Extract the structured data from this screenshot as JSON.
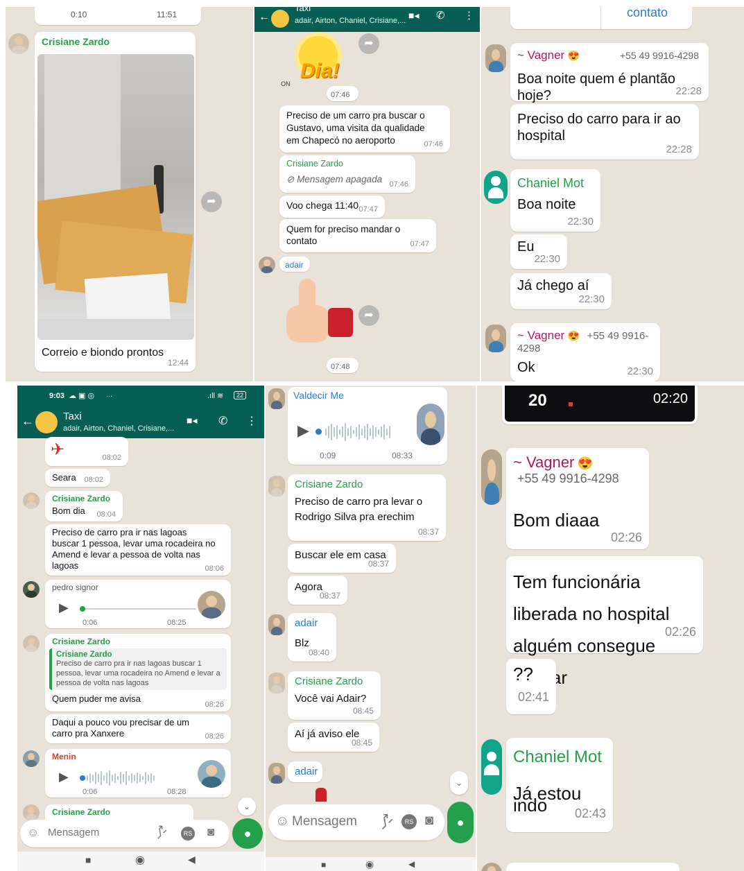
{
  "colors": {
    "header_bg": "#075e54",
    "chat_bg": "#e9e2d8",
    "sender_green": "#25a04a",
    "sender_pink": "#b0185c",
    "mic_green": "#25a04a"
  },
  "panel1": {
    "top_bubble_left": "0:10",
    "top_bubble_right": "11:51",
    "sender": "Crisiane Zardo",
    "caption": "Correio e biondo prontos",
    "time": "12:44"
  },
  "panel2": {
    "title": "Taxi",
    "members": "adair, Airton, Chaniel, Crisiane,...",
    "sticker_time": "07:46",
    "sticker_text": "Dia!",
    "msg1": "Preciso de um carro pra buscar o Gustavo, uma visita da qualidade em Chapecó no aeroporto",
    "msg1_time": "07:46",
    "deleted_sender": "Crisiane Zardo",
    "deleted_text": "Mensagem apagada",
    "deleted_time": "07:46",
    "msg2": "Voo chega 11:40",
    "msg2_time": "07:47",
    "msg3": "Quem for preciso mandar o contato",
    "msg3_time": "07:47",
    "adair_label": "adair",
    "thumb_time": "07:48"
  },
  "panel3": {
    "top_text": "contato",
    "vagner_name": "~ Vagner",
    "vagner_phone": "+55 49 9916-4298",
    "msg1": "Boa noite quem é plantão hoje?",
    "msg1_time": "22:28",
    "msg2": "Preciso do carro para ir ao hospital",
    "msg2_time": "22:28",
    "chaniel_name": "Chaniel Mot",
    "msg3": "Boa noite",
    "msg3_time": "22:30",
    "msg4": "Eu",
    "msg4_time": "22:30",
    "msg5": "Já chego aí",
    "msg5_time": "22:30",
    "vagner2_name": "~ Vagner",
    "vagner2_phone": "+55 49 9916-4298",
    "msg6": "Ok",
    "msg6_time": "22:30"
  },
  "panel4": {
    "status_time": "9:03",
    "status_icons": "...",
    "battery": "22",
    "title": "Taxi",
    "members": "adair, Airton, Chaniel, Crisiane,...",
    "plane_time": "08:02",
    "seara": "Seara",
    "seara_time": "08:02",
    "cz1_name": "Crisiane Zardo",
    "cz1_msg": "Bom dia",
    "cz1_time": "08:04",
    "long_msg": "Preciso de carro pra ir nas lagoas buscar 1 pessoa, levar uma rocadeira no Amend e levar a pessoa de volta nas lagoas",
    "long_time": "08:06",
    "pedro_name": "pedro signor",
    "pedro_dur": "0:06",
    "pedro_time": "08:25",
    "cz2_name": "Crisiane Zardo",
    "quote_name": "Crisiane Zardo",
    "quote_text": "Preciso de carro pra ir nas lagoas buscar 1 pessoa, levar uma rocadeira no Amend e levar a pessoa de volta nas lagoas",
    "reply_msg": "Quem puder me avisa",
    "reply_time": "08:26",
    "xanxere_msg": "Daqui a pouco vou precisar de um carro pra Xanxere",
    "xanxere_time": "08:26",
    "menin_name": "Menin",
    "menin_dur": "0:06",
    "menin_time": "08:28",
    "cz3_name": "Crisiane Zardo",
    "input_placeholder": "Mensagem"
  },
  "panel5": {
    "valdecir_name": "Valdecir Me",
    "voice_dur": "0:09",
    "voice_time": "08:33",
    "cz_name": "Crisiane Zardo",
    "msg1": "Preciso de carro pra levar o Rodrigo Silva pra erechim",
    "msg1_time": "08:37",
    "msg2": "Buscar ele em casa",
    "msg2_time": "08:37",
    "msg3": "Agora",
    "msg3_time": "08:37",
    "adair_name": "adair",
    "msg4": "Blz",
    "msg4_time": "08:40",
    "cz2_name": "Crisiane Zardo",
    "msg5": "Você vai Adair?",
    "msg5_time": "08:45",
    "msg6": "Aí já aviso ele",
    "msg6_time": "08:45",
    "adair2_name": "adair",
    "input_placeholder": "Mensagem"
  },
  "panel6": {
    "video_time": "02:20",
    "video_label": "20",
    "vagner_name": "~ Vagner",
    "vagner_phone": "+55 49 9916-4298",
    "msg1": "Bom diaaa",
    "msg1_time": "02:26",
    "msg2": "Tem funcionária liberada no hospital alguém consegue buscar",
    "msg2_time": "02:26",
    "msg3": "??",
    "msg3_time": "02:41",
    "chaniel_name": "Chaniel Mot",
    "msg4": "Já estou indo",
    "msg4_time": "02:43"
  }
}
